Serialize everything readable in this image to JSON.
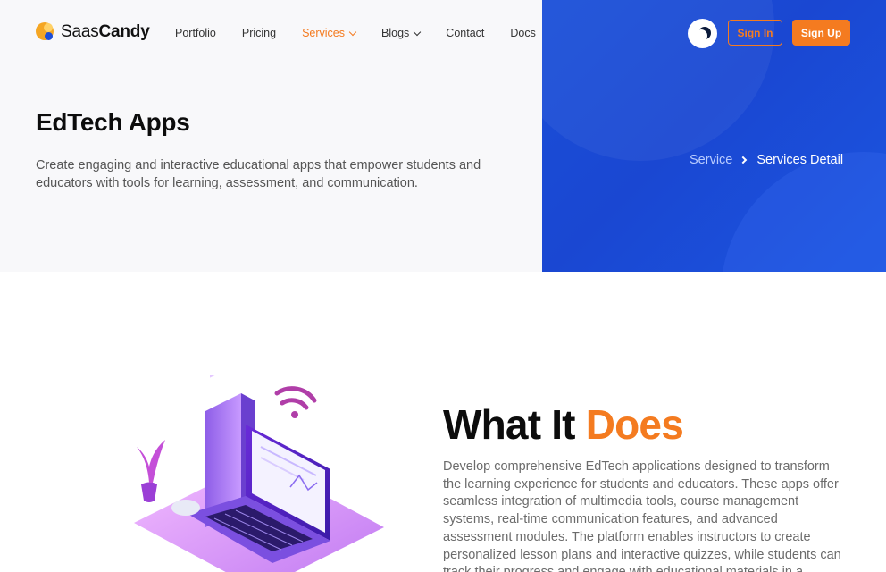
{
  "header": {
    "logo": {
      "text_regular": "Saas",
      "text_bold": "Candy",
      "icon": "saascandy-logo-icon"
    },
    "nav": [
      {
        "label": "Portfolio",
        "active": false,
        "dropdown": false
      },
      {
        "label": "Pricing",
        "active": false,
        "dropdown": false
      },
      {
        "label": "Services",
        "active": true,
        "dropdown": true
      },
      {
        "label": "Blogs",
        "active": false,
        "dropdown": true
      },
      {
        "label": "Contact",
        "active": false,
        "dropdown": false
      },
      {
        "label": "Docs",
        "active": false,
        "dropdown": false
      }
    ],
    "theme_toggle_icon": "moon-icon",
    "signin_label": "Sign In",
    "signup_label": "Sign Up"
  },
  "hero": {
    "title": "EdTech Apps",
    "description": "Create engaging and interactive educational apps that empower students and educators with tools for learning, assessment, and communication.",
    "breadcrumb": {
      "parent": "Service",
      "current": "Services Detail"
    }
  },
  "section": {
    "title_main": "What It",
    "title_accent": "Does",
    "text": "Develop comprehensive EdTech applications designed to transform the learning experience for students and educators. These apps offer seamless integration of multimedia tools, course management systems, real-time communication features, and advanced assessment modules. The platform enables instructors to create personalized lesson plans and interactive quizzes, while students can track their progress and engage with educational materials in a"
  },
  "colors": {
    "accent": "#f47b20",
    "hero_blue": "#1a4fd8",
    "hero_bg": "#f8f8fa"
  }
}
